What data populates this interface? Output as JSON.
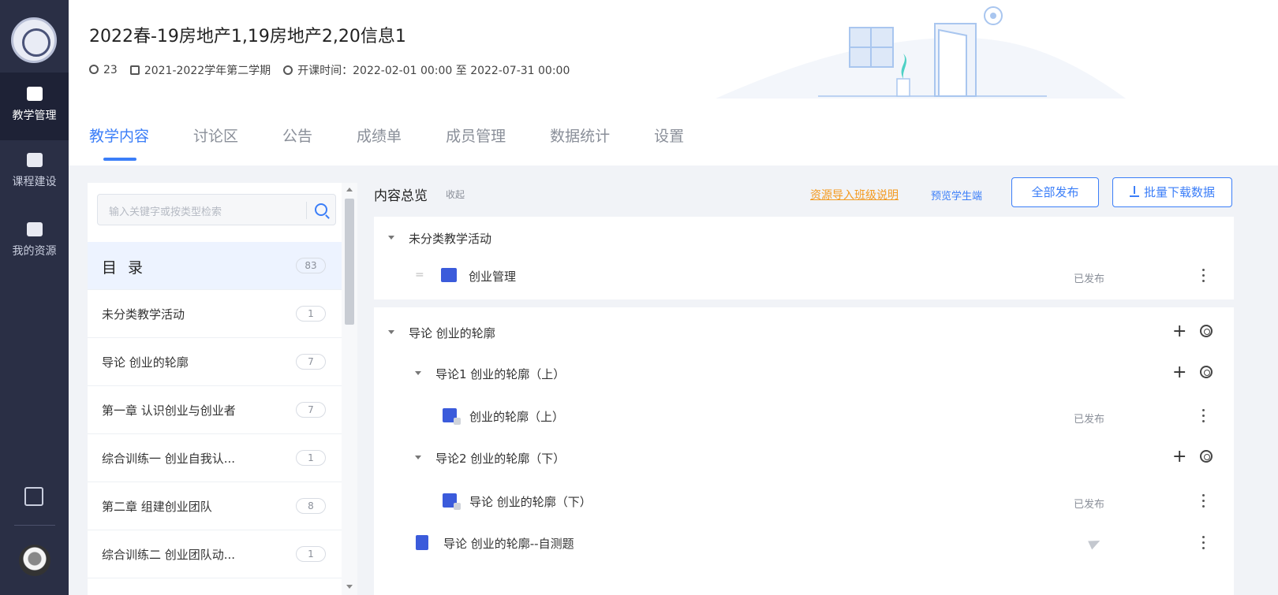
{
  "sidebar": {
    "items": [
      {
        "label": "教学管理",
        "active": true
      },
      {
        "label": "课程建设"
      },
      {
        "label": "我的资源"
      }
    ]
  },
  "header": {
    "title": "2022春-19房地产1,19房地产2,20信息1",
    "members": "23",
    "semester": "2021-2022学年第二学期",
    "schedule": "开课时间：2022-02-01 00:00 至 2022-07-31 00:00",
    "tabs": [
      "教学内容",
      "讨论区",
      "公告",
      "成绩单",
      "成员管理",
      "数据统计",
      "设置"
    ],
    "active_tab": "教学内容"
  },
  "directory": {
    "search_placeholder": "输入关键字或按类型检索",
    "items": [
      {
        "label": "目 录",
        "count": "83"
      },
      {
        "label": "未分类教学活动",
        "count": "1"
      },
      {
        "label": "导论  创业的轮廓",
        "count": "7"
      },
      {
        "label": "第一章  认识创业与创业者",
        "count": "7"
      },
      {
        "label": "综合训练一  创业自我认...",
        "count": "1"
      },
      {
        "label": "第二章  组建创业团队",
        "count": "8"
      },
      {
        "label": "综合训练二  创业团队动...",
        "count": "1"
      }
    ]
  },
  "content": {
    "title": "内容总览",
    "collapse": "收起",
    "import_link": "资源导入班级说明",
    "preview_link": "预览学生端",
    "publish_all": "全部发布",
    "batch_download": "批量下载数据",
    "group1": {
      "title": "未分类教学活动",
      "item": {
        "label": "创业管理",
        "status": "已发布",
        "icon": "discussion-icon"
      }
    },
    "group2": {
      "title": "导论 创业的轮廓",
      "sub1": {
        "title": "导论1 创业的轮廓（上）",
        "item": {
          "label": "创业的轮廓（上）",
          "status": "已发布",
          "icon": "video-icon"
        }
      },
      "sub2": {
        "title": "导论2 创业的轮廓（下）",
        "item": {
          "label": "导论 创业的轮廓（下）",
          "status": "已发布",
          "icon": "video-icon"
        }
      },
      "test": {
        "label": "导论 创业的轮廓--自测题",
        "icon": "test-icon"
      }
    }
  },
  "colors": {
    "accent": "#3b7ef8",
    "nav_bg": "#2a2f45",
    "link_orange": "#f39a1f"
  }
}
